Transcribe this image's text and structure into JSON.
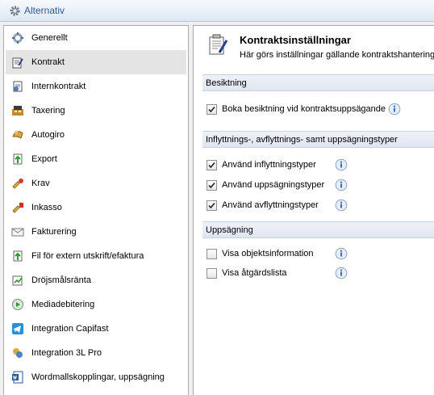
{
  "window": {
    "title": "Alternativ",
    "icon": "gear-icon"
  },
  "sidebar": {
    "items": [
      {
        "label": "Generellt",
        "icon": "generic-settings-icon"
      },
      {
        "label": "Kontrakt",
        "icon": "contract-icon",
        "selected": true
      },
      {
        "label": "Internkontrakt",
        "icon": "internal-contract-icon"
      },
      {
        "label": "Taxering",
        "icon": "taxation-icon"
      },
      {
        "label": "Autogiro",
        "icon": "autogiro-icon"
      },
      {
        "label": "Export",
        "icon": "export-icon"
      },
      {
        "label": "Krav",
        "icon": "krav-icon"
      },
      {
        "label": "Inkasso",
        "icon": "inkasso-icon"
      },
      {
        "label": "Fakturering",
        "icon": "envelope-icon"
      },
      {
        "label": "Fil för extern utskrift/efaktura",
        "icon": "file-export-icon"
      },
      {
        "label": "Dröjsmålsränta",
        "icon": "interest-icon"
      },
      {
        "label": "Mediadebitering",
        "icon": "media-icon"
      },
      {
        "label": "Integration Capifast",
        "icon": "telegram-icon"
      },
      {
        "label": "Integration 3L Pro",
        "icon": "integration-icon"
      },
      {
        "label": "Wordmallskopplingar, uppsägning",
        "icon": "word-icon"
      }
    ]
  },
  "main": {
    "title": "Kontraktsinställningar",
    "subtitle": "Här görs inställningar gällande kontraktshantering",
    "sections": [
      {
        "heading": "Besiktning",
        "options": [
          {
            "label": "Boka besiktning vid kontraktsuppsägande",
            "checked": true
          }
        ]
      },
      {
        "heading": "Inflyttnings-, avflyttnings- samt uppsägningstyper",
        "options": [
          {
            "label": "Använd inflyttningstyper",
            "checked": true
          },
          {
            "label": "Använd uppsägningstyper",
            "checked": true
          },
          {
            "label": "Använd avflyttningstyper",
            "checked": true
          }
        ]
      },
      {
        "heading": "Uppsägning",
        "options": [
          {
            "label": "Visa objektsinformation",
            "checked": false
          },
          {
            "label": "Visa åtgärdslista",
            "checked": false
          }
        ]
      }
    ]
  },
  "colors": {
    "title_text": "#2e5c8e",
    "selected_bg": "#e4e4e4",
    "section_bg": "#e4eaf2",
    "info_blue": "#3a6fb0"
  }
}
